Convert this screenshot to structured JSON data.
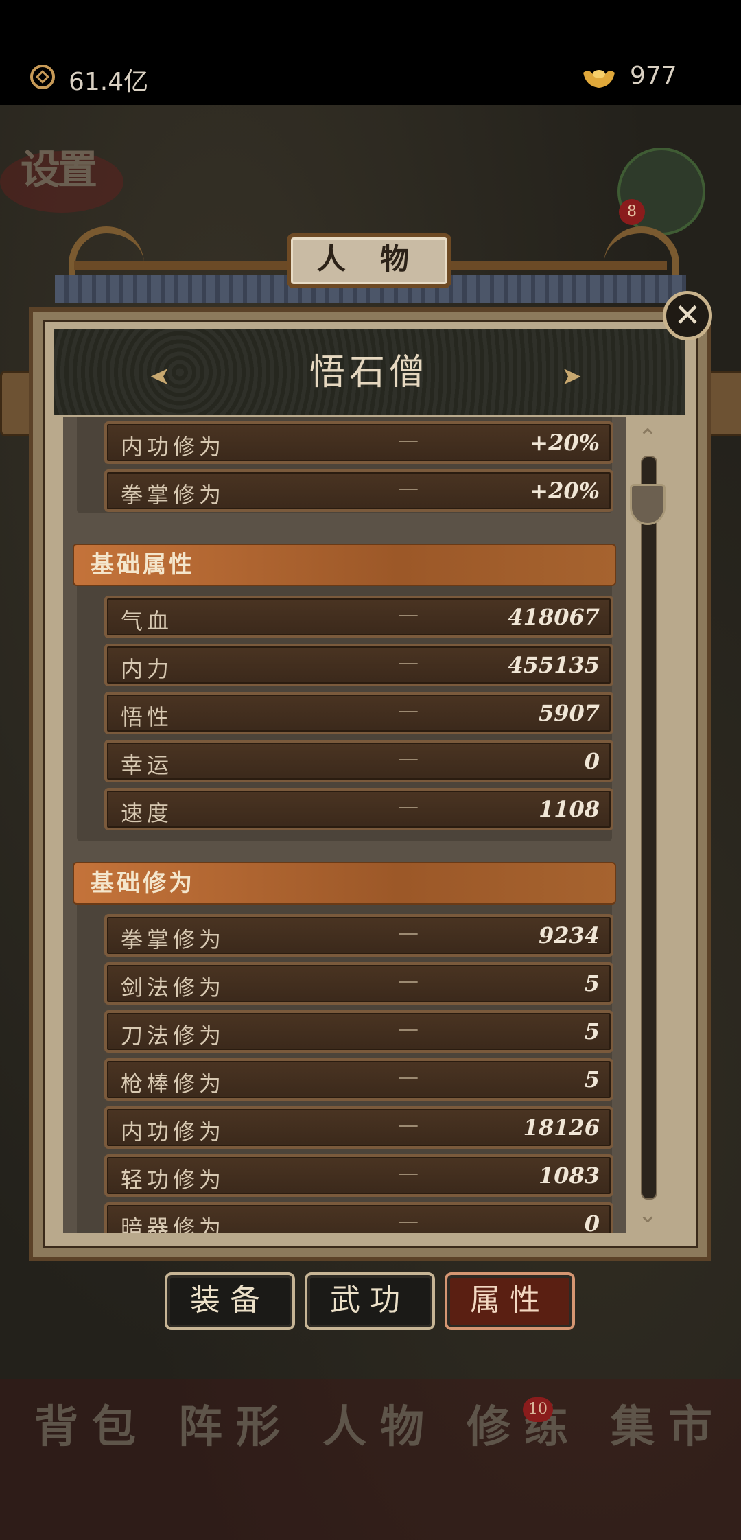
{
  "topbar": {
    "coins": "61.4亿",
    "ingots": "977"
  },
  "background": {
    "settings_label": "设置",
    "avatar_badge": "8"
  },
  "panel": {
    "title": "人 物",
    "character_name": "悟石僧",
    "close_label": "✕",
    "prev_arrow": "➤",
    "next_arrow": "➤"
  },
  "top_partial_rows": [
    {
      "name": "内功修为",
      "sep": "—",
      "value": "+20%"
    },
    {
      "name": "拳掌修为",
      "sep": "—",
      "value": "+20%"
    }
  ],
  "base_attributes": {
    "header": "基础属性",
    "rows": [
      {
        "name": "气血",
        "sep": "—",
        "value": "418067"
      },
      {
        "name": "内力",
        "sep": "—",
        "value": "455135"
      },
      {
        "name": "悟性",
        "sep": "—",
        "value": "5907"
      },
      {
        "name": "幸运",
        "sep": "—",
        "value": "0"
      },
      {
        "name": "速度",
        "sep": "—",
        "value": "1108"
      }
    ]
  },
  "base_cultivation": {
    "header": "基础修为",
    "rows": [
      {
        "name": "拳掌修为",
        "sep": "—",
        "value": "9234"
      },
      {
        "name": "剑法修为",
        "sep": "—",
        "value": "5"
      },
      {
        "name": "刀法修为",
        "sep": "—",
        "value": "5"
      },
      {
        "name": "枪棒修为",
        "sep": "—",
        "value": "5"
      },
      {
        "name": "内功修为",
        "sep": "—",
        "value": "18126"
      },
      {
        "name": "轻功修为",
        "sep": "—",
        "value": "1083"
      },
      {
        "name": "暗器修为",
        "sep": "—",
        "value": "0"
      }
    ]
  },
  "tabs": [
    {
      "label": "装备",
      "active": false
    },
    {
      "label": "武功",
      "active": false
    },
    {
      "label": "属性",
      "active": true
    }
  ],
  "bottom_nav": {
    "items": [
      "背包",
      "阵形",
      "人物",
      "修练",
      "集市"
    ],
    "badge": "10"
  },
  "colors": {
    "accent": "#c4733a",
    "active_tab": "#5a1f12"
  }
}
